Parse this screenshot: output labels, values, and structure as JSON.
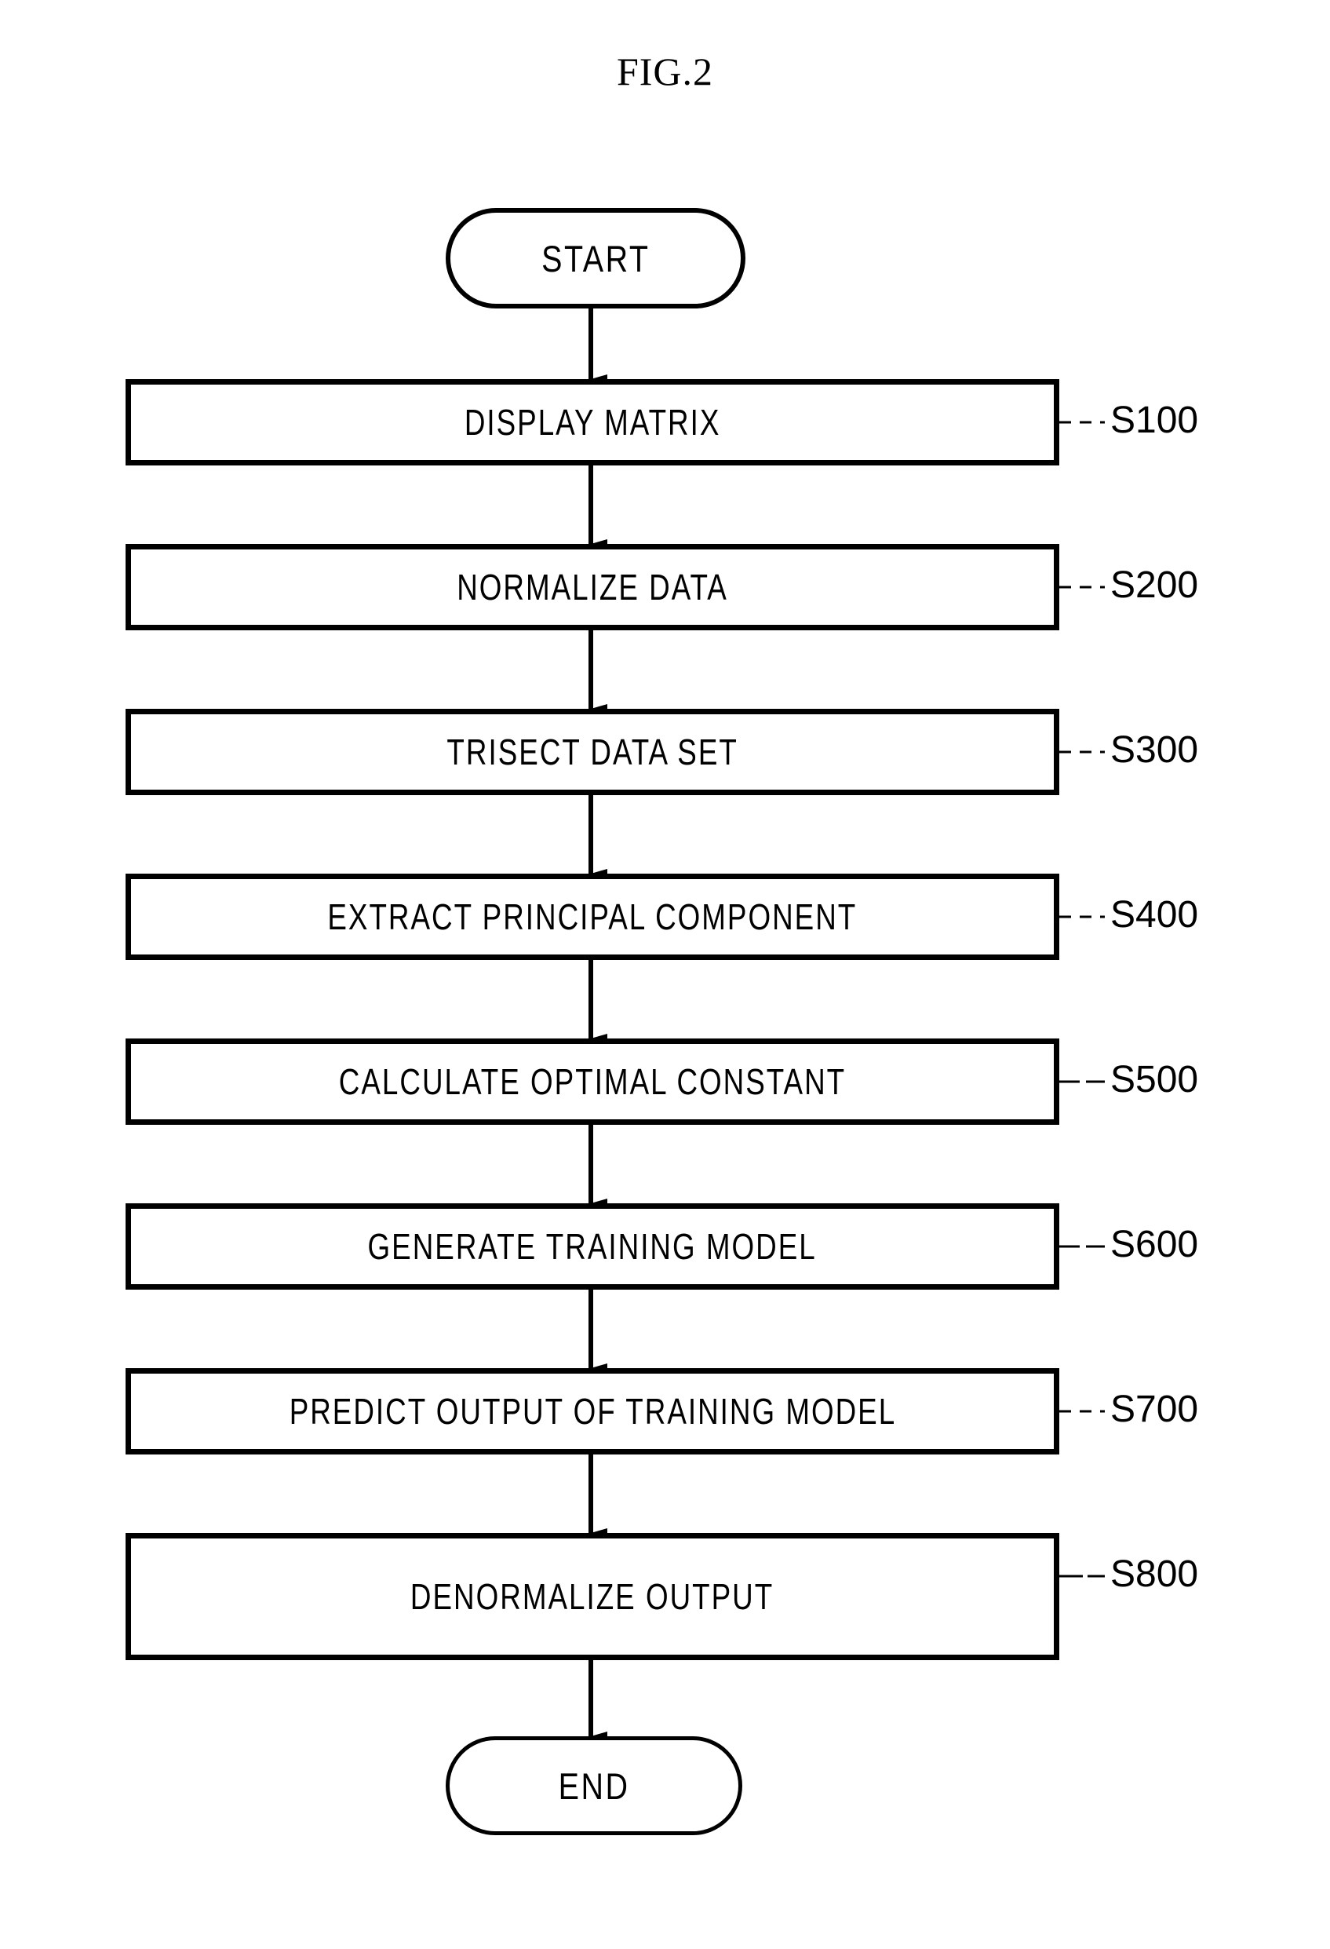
{
  "figure": {
    "title": "FIG.2",
    "type": "flowchart",
    "orientation": "vertical",
    "colors": {
      "stroke": "#000000",
      "fill": "#ffffff",
      "text": "#000000"
    }
  },
  "nodes": {
    "start": {
      "label": "START",
      "shape": "terminator"
    },
    "end": {
      "label": "END",
      "shape": "terminator"
    }
  },
  "steps": [
    {
      "label": "DISPLAY MATRIX",
      "ref": "S100"
    },
    {
      "label": "NORMALIZE DATA",
      "ref": "S200"
    },
    {
      "label": "TRISECT DATA SET",
      "ref": "S300"
    },
    {
      "label": "EXTRACT PRINCIPAL COMPONENT",
      "ref": "S400"
    },
    {
      "label": "CALCULATE OPTIMAL CONSTANT",
      "ref": "S500"
    },
    {
      "label": "GENERATE TRAINING MODEL",
      "ref": "S600"
    },
    {
      "label": "PREDICT OUTPUT OF TRAINING MODEL",
      "ref": "S700"
    },
    {
      "label": "DENORMALIZE OUTPUT",
      "ref": "S800"
    }
  ]
}
